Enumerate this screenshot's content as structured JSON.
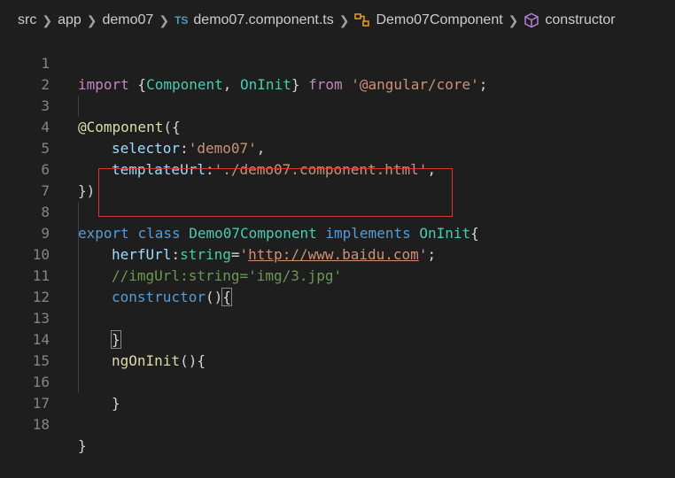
{
  "breadcrumb": {
    "items": [
      "src",
      "app",
      "demo07",
      "demo07.component.ts",
      "Demo07Component",
      "constructor"
    ],
    "file_icon_label": "TS"
  },
  "code": {
    "line_numbers": [
      "1",
      "2",
      "3",
      "4",
      "5",
      "6",
      "7",
      "8",
      "9",
      "10",
      "11",
      "12",
      "13",
      "14",
      "15",
      "16",
      "17",
      "18"
    ],
    "l1": {
      "import": "import",
      "open": " {",
      "c1": "Component",
      "comma": ", ",
      "c2": "OnInit",
      "close": "} ",
      "from": "from",
      "sp": " ",
      "mod": "'@angular/core'",
      "semi": ";"
    },
    "l3": {
      "at": "@Component",
      "rest": "({"
    },
    "l4": {
      "key": "selector",
      "colon": ":",
      "val": "'demo07'",
      "comma": ","
    },
    "l5": {
      "key": "templateUrl",
      "colon": ":",
      "val": "'./demo07.component.html'",
      "comma": ","
    },
    "l6": {
      "text": "})"
    },
    "l8": {
      "export": "export",
      "class": "class",
      "name": "Demo07Component",
      "implements": "implements",
      "iface": "OnInit",
      "brace": "{"
    },
    "l9": {
      "key": "herfUrl",
      "colon": ":",
      "type": "string",
      "eq": "=",
      "q1": "'",
      "url": "http://www.baidu.com",
      "q2": "'",
      "semi": ";"
    },
    "l10": {
      "comment": "//imgUrl:string='img/3.jpg'"
    },
    "l11": {
      "ctor": "constructor",
      "parens": "()",
      "brace": "{"
    },
    "l13": {
      "brace": "}"
    },
    "l14": {
      "fn": "ngOnInit",
      "rest": "(){"
    },
    "l16": {
      "brace": "}"
    },
    "l18": {
      "brace": "}"
    }
  }
}
